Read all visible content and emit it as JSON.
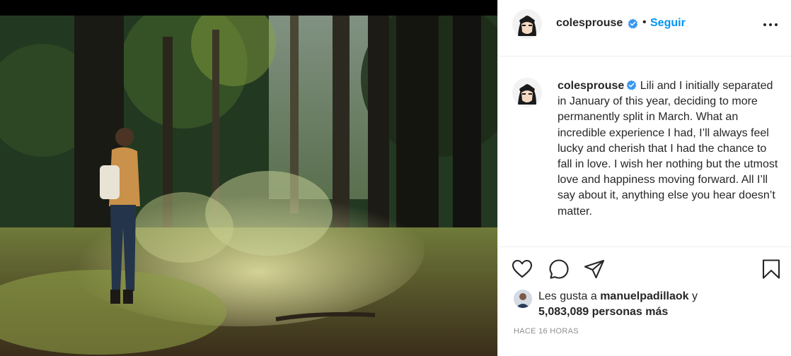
{
  "post": {
    "username": "colesprouse",
    "separator": "•",
    "follow_label": "Seguir",
    "more_icon": "more-icon",
    "caption": "Lili and I initially separated in January of this year, deciding to more permanently split in March. What an incredible experience I had, I’ll always feel lucky and cherish that I had the chance to fall in love. I wish her nothing but the utmost love and happiness moving forward. All I’ll say about it, anything else you hear doesn’t matter.",
    "likes": {
      "prefix": "Les gusta a",
      "liker": "manuelpadillaok",
      "conj": "y",
      "others": "5,083,089 personas más"
    },
    "timestamp": "HACE 16 HORAS"
  },
  "icons": {
    "verified": "verified-badge-icon",
    "like": "heart-icon",
    "comment": "comment-icon",
    "share": "share-icon",
    "save": "bookmark-icon"
  },
  "colors": {
    "accent": "#0095f6",
    "verified": "#3897f0",
    "text": "#262626",
    "muted": "#8e8e8e",
    "divider": "#efefef"
  }
}
